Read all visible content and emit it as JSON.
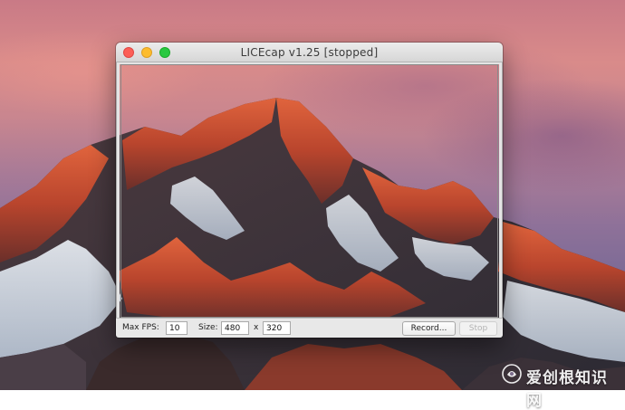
{
  "window": {
    "title": "LICEcap v1.25 [stopped]"
  },
  "controls": {
    "max_fps_label": "Max FPS:",
    "max_fps_value": "10",
    "size_label": "Size:",
    "width_value": "480",
    "by_label": "x",
    "height_value": "320",
    "record_label": "Record...",
    "stop_label": "Stop"
  },
  "watermark": {
    "text": "爱创根知识网",
    "icon": "watermark-logo-icon"
  },
  "colors": {
    "close": "#fc5f57",
    "minimize": "#fdbc2e",
    "zoom": "#29c840"
  }
}
